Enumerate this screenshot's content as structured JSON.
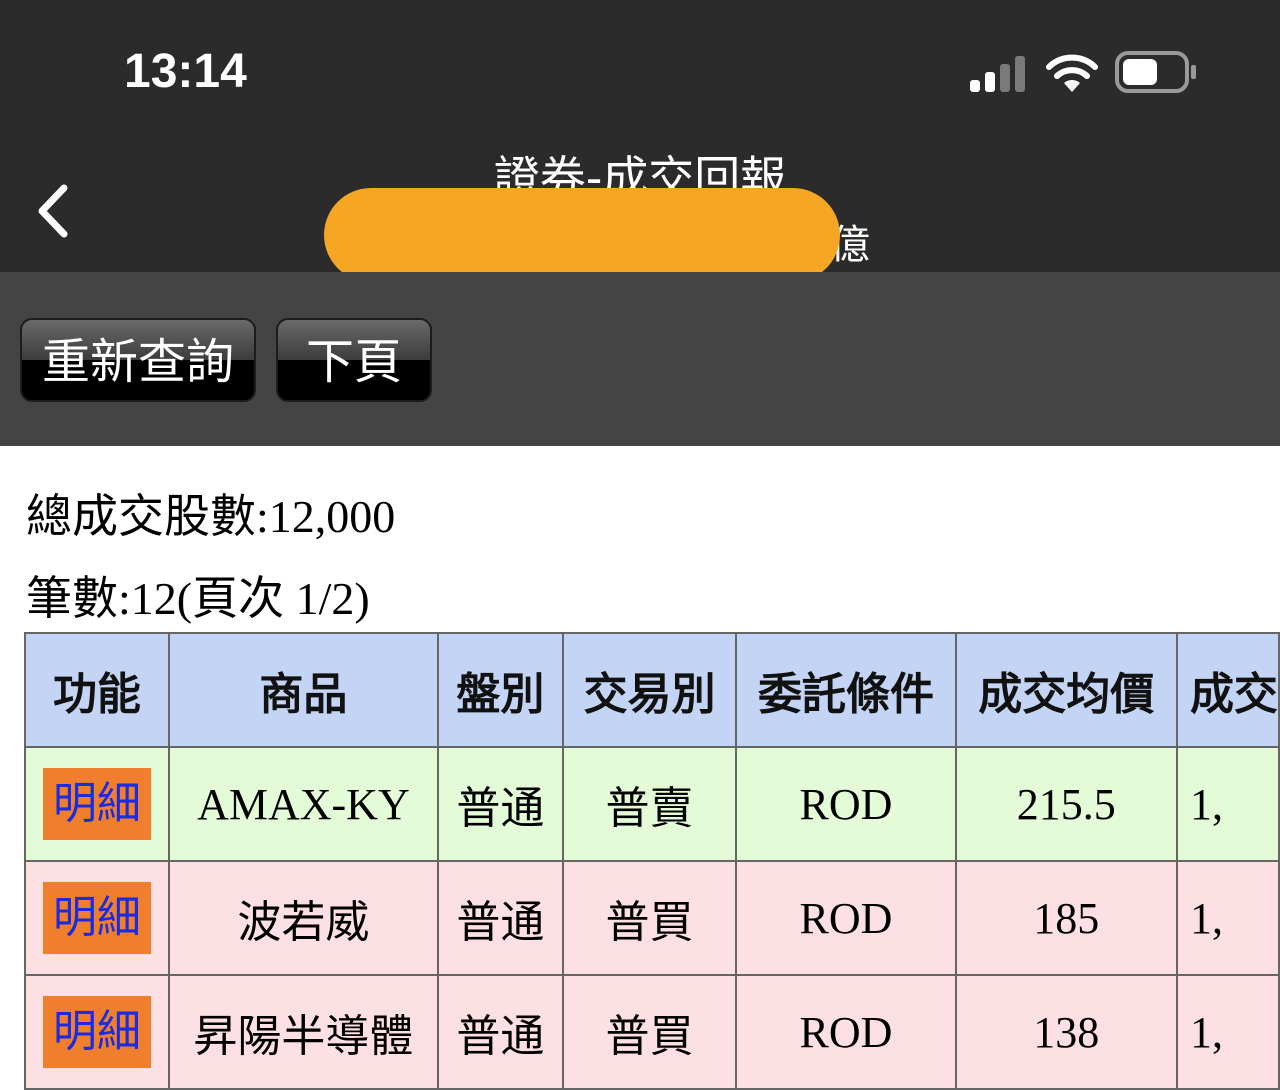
{
  "status_bar": {
    "time": "13:14",
    "icons": [
      "cellular-signal-icon",
      "wifi-icon",
      "battery-icon"
    ]
  },
  "nav": {
    "title": "證券-成交回報",
    "subtitle_visible_fragment": "億",
    "back_icon": "chevron-left-icon",
    "redaction_color": "#f5a622"
  },
  "toolbar": {
    "requery_label": "重新查詢",
    "next_page_label": "下頁"
  },
  "summary": {
    "total_shares": "總成交股數:12,000",
    "count_line": "筆數:12(頁次 1/2)"
  },
  "table": {
    "headers": [
      "功能",
      "商品",
      "盤別",
      "交易別",
      "委託條件",
      "成交均價",
      "成交"
    ],
    "rows": [
      {
        "action": "明細",
        "product": "AMAX-KY",
        "session": "普通",
        "trade": "普賣",
        "condition": "ROD",
        "avg_price": "215.5",
        "more": "1,"
      },
      {
        "action": "明細",
        "product": "波若威",
        "session": "普通",
        "trade": "普買",
        "condition": "ROD",
        "avg_price": "185",
        "more": "1,"
      },
      {
        "action": "明細",
        "product": "昇陽半導體",
        "session": "普通",
        "trade": "普買",
        "condition": "ROD",
        "avg_price": "138",
        "more": "1,"
      }
    ]
  },
  "colors": {
    "header_bg": "#c3d4f5",
    "sell_row_bg": "#e3fbd7",
    "buy_row_bg": "#fde0e3",
    "sell_text": "#1f9a1f",
    "buy_text": "#ee1111",
    "detail_button_bg": "#f07f2d",
    "product_text": "#1a1ad8"
  }
}
